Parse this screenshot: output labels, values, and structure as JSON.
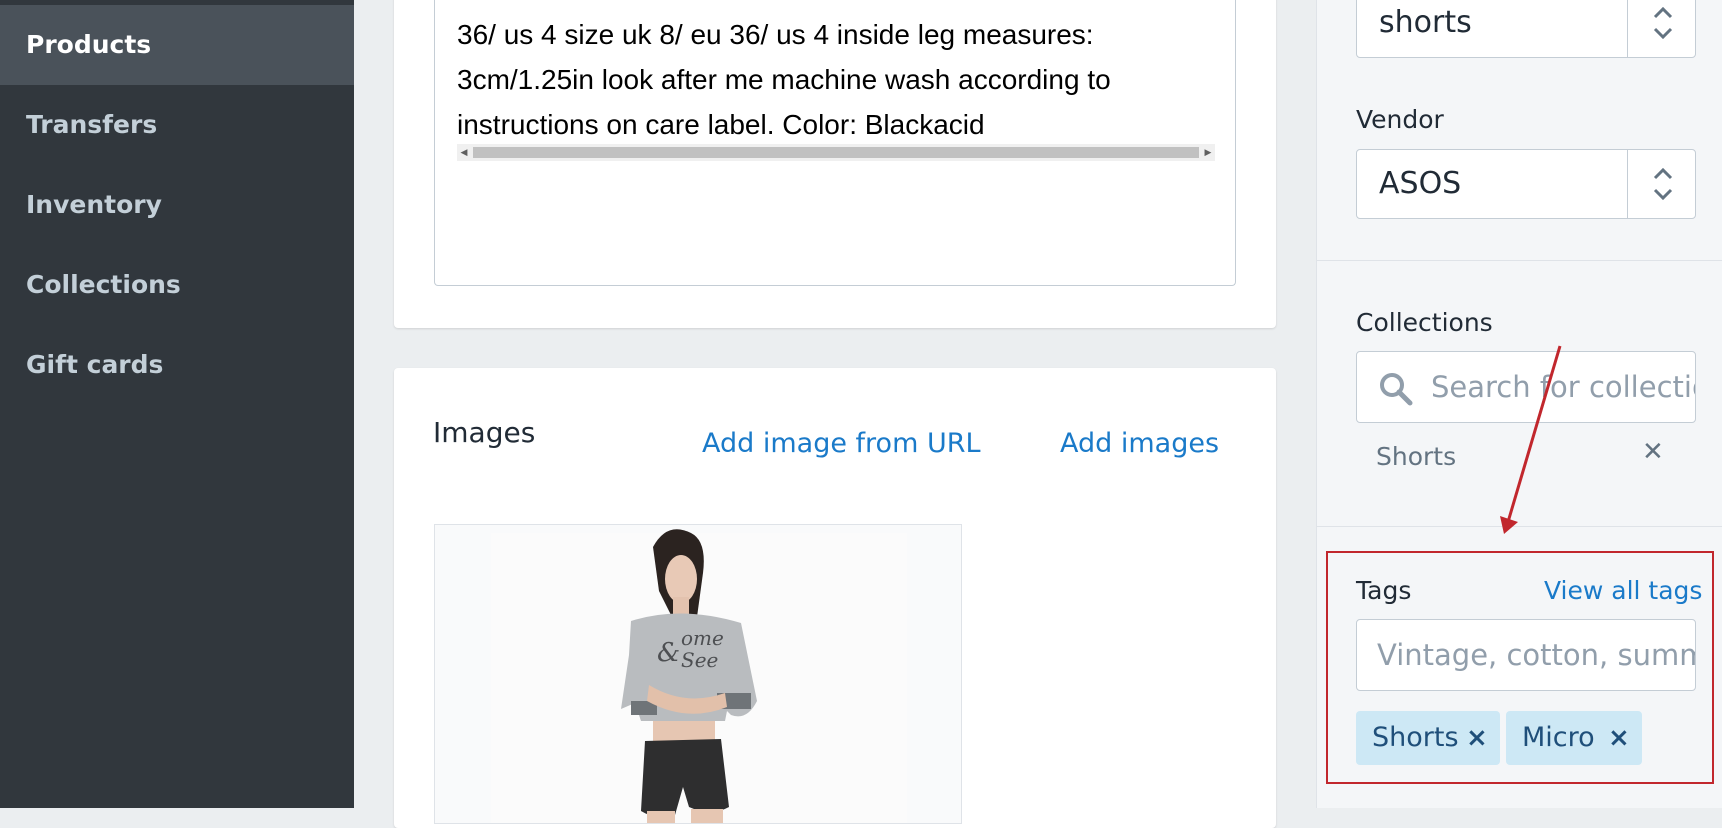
{
  "sidebar": {
    "items": [
      {
        "label": "Products",
        "active": true
      },
      {
        "label": "Transfers"
      },
      {
        "label": "Inventory"
      },
      {
        "label": "Collections"
      },
      {
        "label": "Gift cards"
      }
    ]
  },
  "description": {
    "lines": [
      "36/ us 4 size uk 8/ eu 36/ us 4 inside leg measures:",
      "3cm/1.25in look after me machine wash according to",
      "instructions on care label. Color: Blackacid"
    ]
  },
  "images": {
    "title": "Images",
    "add_from_url": "Add image from URL",
    "add_images": "Add images",
    "image_print": "Come & See"
  },
  "organization": {
    "product_type_value": "shorts",
    "vendor_label": "Vendor",
    "vendor_value": "ASOS",
    "collections_label": "Collections",
    "collections_placeholder": "Search for collections",
    "collections": [
      {
        "label": "Shorts"
      }
    ],
    "tags_label": "Tags",
    "view_all_tags": "View all tags",
    "tags_placeholder": "Vintage, cotton, summer",
    "tags": [
      {
        "label": "Shorts"
      },
      {
        "label": "Micro"
      }
    ]
  },
  "colors": {
    "sidebar_bg": "#31373d",
    "link": "#1a7ac9",
    "tag_bg": "#cde8f5",
    "annotation": "#c1272d"
  }
}
